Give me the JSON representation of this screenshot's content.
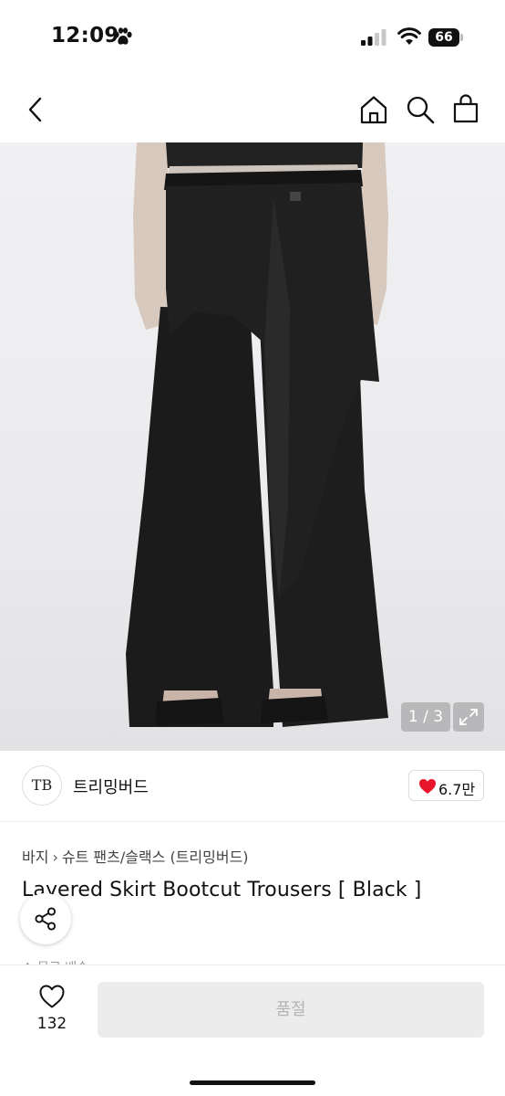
{
  "status_bar": {
    "time": "12:09",
    "battery": "66"
  },
  "nav": {
    "icons": [
      "back-icon",
      "home-icon",
      "search-icon",
      "shopping-bag-icon"
    ]
  },
  "gallery": {
    "counter": "1 / 3",
    "current": 1,
    "total": 3
  },
  "seller": {
    "logo_text": "TB",
    "name": "트리밍버드",
    "likes": "6.7만"
  },
  "breadcrumb": {
    "category": "바지",
    "subcategory": "슈트 팬츠/슬랙스 (트리밍버드)"
  },
  "product": {
    "title": "Layered Skirt Bootcut Trousers [ Black ]",
    "peek_text": "♦ 무료 배송"
  },
  "bottom_bar": {
    "wish_count": "132",
    "soldout_label": "품절"
  },
  "colors": {
    "heart": "#e8162a",
    "soldout_bg": "#ececec",
    "soldout_text": "#b4b4b4"
  }
}
